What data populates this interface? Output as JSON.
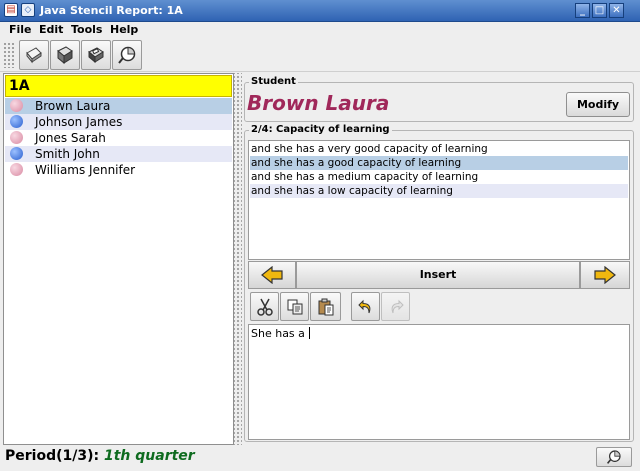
{
  "window": {
    "title": "Java Stencil Report: 1A"
  },
  "menubar": {
    "items": [
      "File",
      "Edit",
      "Tools",
      "Help"
    ]
  },
  "toolbar": {
    "icons": [
      "new-document-icon",
      "open-documents-icon",
      "save-disk-icon",
      "chart-pie-icon"
    ]
  },
  "class_list": {
    "title": "1A",
    "students": [
      {
        "name": "Brown Laura",
        "gender_color": "#e8a2b6",
        "selected": true
      },
      {
        "name": "Johnson James",
        "gender_color": "#3d6fd6",
        "selected": false
      },
      {
        "name": "Jones Sarah",
        "gender_color": "#e8a2b6",
        "selected": false
      },
      {
        "name": "Smith John",
        "gender_color": "#3d6fd6",
        "selected": false
      },
      {
        "name": "Williams Jennifer",
        "gender_color": "#e8a2b6",
        "selected": false
      }
    ]
  },
  "student_panel": {
    "legend": "Student",
    "name": "Brown Laura",
    "modify_label": "Modify"
  },
  "phrase_panel": {
    "legend": "2/4: Capacity of learning",
    "phrases": [
      "and she has a very good capacity of learning",
      "and she has a good capacity of learning",
      "and she has a medium capacity of learning",
      "and she has a low capacity of learning"
    ],
    "selected_index": 1,
    "insert_label": "Insert"
  },
  "editor": {
    "text": "She has a",
    "tools": [
      "cut-icon",
      "copy-icon",
      "paste-icon",
      "undo-icon",
      "redo-icon"
    ]
  },
  "status": {
    "period_label": "Period",
    "period_value": "1/3",
    "quarter": "1th quarter"
  },
  "colors": {
    "title_gradient_top": "#5f8fd0",
    "class_header": "#ffff00",
    "selected_row": "#b8cfe5",
    "alt_row": "#e6e8f6",
    "student_name": "#a0285a",
    "quarter_text": "#0e6b1f",
    "nav_arrow": "#f0b80f"
  }
}
